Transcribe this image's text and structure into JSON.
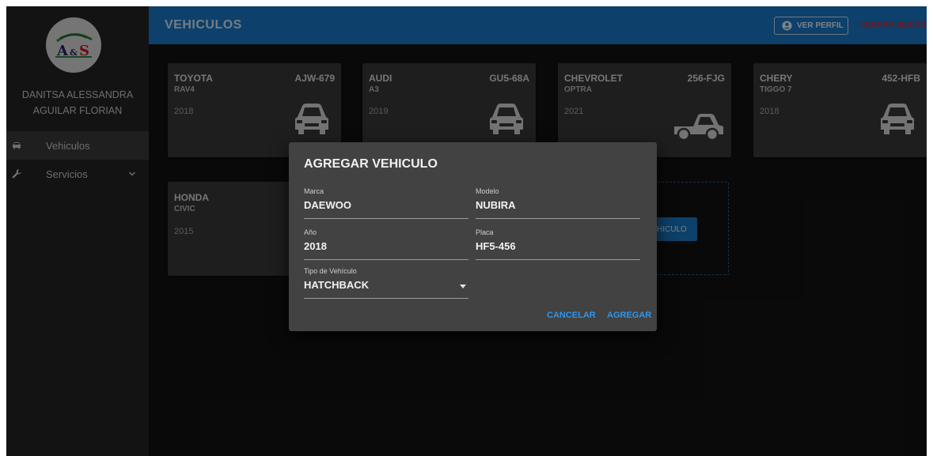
{
  "sidebar": {
    "user_name_line1": "DANITSA ALESSANDRA",
    "user_name_line2": "AGUILAR FLORIAN",
    "items": [
      {
        "label": "Vehiculos",
        "icon": "car-icon"
      },
      {
        "label": "Servicios",
        "icon": "wrench-icon"
      }
    ]
  },
  "header": {
    "title": "VEHICULOS",
    "profile_label": "VER PERFIL",
    "logout_label": "CERRAR SESIÓN",
    "color": "#1976c4"
  },
  "vehicles": [
    {
      "brand": "TOYOTA",
      "model": "RAV4",
      "year": "2018",
      "plate": "AJW-679",
      "type": "sedan"
    },
    {
      "brand": "AUDI",
      "model": "A3",
      "year": "2019",
      "plate": "GU5-68A",
      "type": "sedan"
    },
    {
      "brand": "CHEVROLET",
      "model": "OPTRA",
      "year": "2021",
      "plate": "256-FJG",
      "type": "pickup"
    },
    {
      "brand": "CHERY",
      "model": "TIGGO 7",
      "year": "2018",
      "plate": "452-HFB",
      "type": "sedan"
    },
    {
      "brand": "HONDA",
      "model": "CIVIC",
      "year": "2015",
      "plate": "",
      "type": "sedan"
    }
  ],
  "add_card_button_label": "HICULO",
  "dialog": {
    "title": "AGREGAR VEHICULO",
    "fields": {
      "marca": {
        "label": "Marca",
        "value": "DAEWOO"
      },
      "modelo": {
        "label": "Modelo",
        "value": "NUBIRA"
      },
      "anio": {
        "label": "Año",
        "value": "2018"
      },
      "placa": {
        "label": "Placa",
        "value": "HF5-456"
      },
      "tipo": {
        "label": "Tipo de Vehículo",
        "value": "HATCHBACK"
      }
    },
    "cancel_label": "CANCELAR",
    "add_label": "AGREGAR"
  },
  "colors": {
    "accent": "#1976c4",
    "logout": "#d0293a",
    "dialog_button": "#2f95ea"
  }
}
